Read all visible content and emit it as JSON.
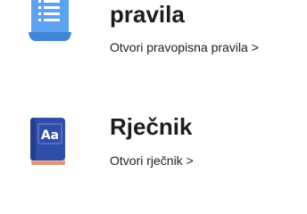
{
  "rules": {
    "icon": "document-list-icon",
    "title": "pravila",
    "link": "Otvori pravopisna pravila >"
  },
  "dictionary": {
    "icon": "dictionary-book-icon",
    "icon_text": "Aa",
    "title": "Rječnik",
    "link": "Otvori rječnik >"
  },
  "colors": {
    "rules_icon": "#4a90e2",
    "dictionary_icon": "#2f4ea8",
    "dictionary_pages": "#f1b79f",
    "text": "#1d1d1f"
  }
}
